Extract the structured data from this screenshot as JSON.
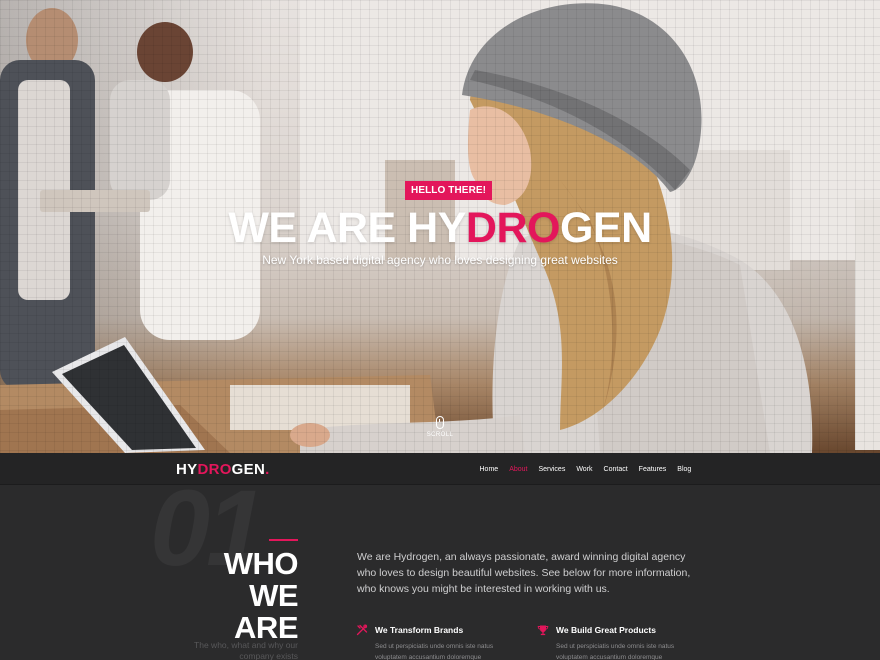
{
  "hero": {
    "badge": "HELLO THERE!",
    "title_part1": "WE ARE HY",
    "title_accent": "DRO",
    "title_part2": "GEN",
    "subtitle": "New York based digital agency who loves designing great websites",
    "scroll_label": "SCROLL"
  },
  "navbar": {
    "logo_part1": "HY",
    "logo_accent": "DRO",
    "logo_part2": "GEN",
    "logo_dot": ".",
    "links": [
      "Home",
      "About",
      "Services",
      "Work",
      "Contact",
      "Features",
      "Blog"
    ],
    "active_link": "About"
  },
  "about": {
    "number": "01",
    "heading_line1": "WHO",
    "heading_line2": "WE",
    "heading_line3": "ARE",
    "subheading": "The who, what and why our company exists",
    "intro": "We are Hydrogen, an always passionate, award winning digital agency who loves to design beautiful websites. See below for more information, who knows you might be interested in working with us.",
    "features": [
      {
        "icon": "tools-icon",
        "title": "We Transform Brands",
        "text": "Sed ut perspiciatis unde omnis iste natus voluptatem accusantium doloremque"
      },
      {
        "icon": "trophy-icon",
        "title": "We Build Great Products",
        "text": "Sed ut perspiciatis unde omnis iste natus voluptatem accusantium doloremque"
      }
    ]
  },
  "colors": {
    "accent": "#e3165b",
    "navbar_bg": "#242425",
    "section_bg": "#2b2b2c"
  }
}
